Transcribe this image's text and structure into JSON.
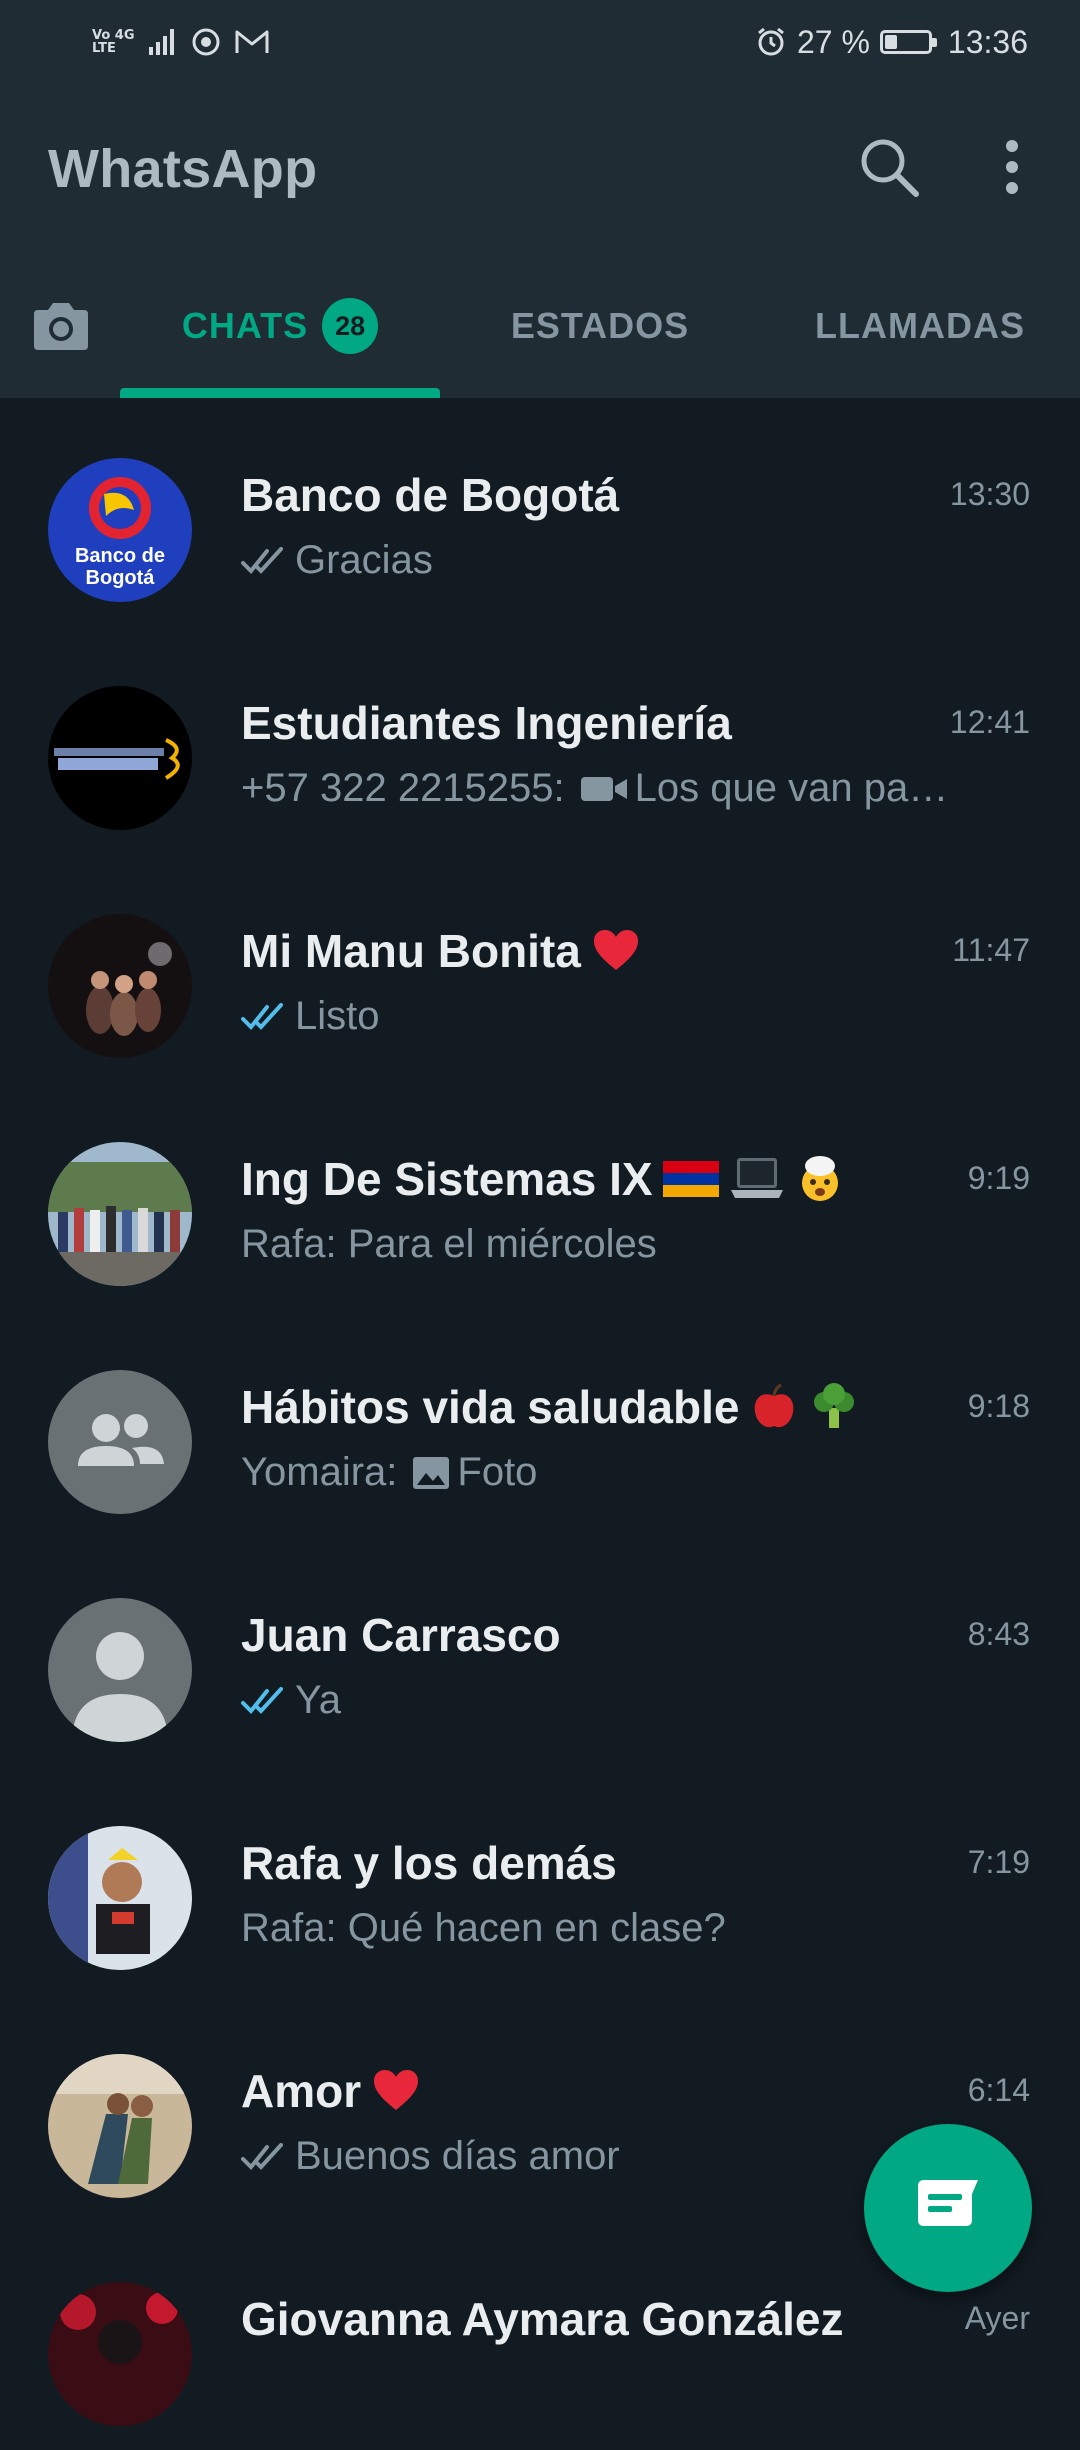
{
  "status_bar": {
    "network_top": "Vo 4G",
    "network_bottom": "LTE",
    "battery_percent": "27 %",
    "battery_level": 0.27,
    "time": "13:36"
  },
  "header": {
    "title": "WhatsApp",
    "icons": [
      "search-icon",
      "more-options-icon"
    ]
  },
  "tabs": [
    {
      "label": "CHATS",
      "badge": "28",
      "active": true
    },
    {
      "label": "ESTADOS",
      "active": false
    },
    {
      "label": "LLAMADAS",
      "active": false
    }
  ],
  "chats": [
    {
      "name": "Banco de Bogotá",
      "time": "13:30",
      "preview": "Gracias",
      "ticks": "read-grey",
      "avatar_text_1": "Banco de",
      "avatar_text_2": "Bogotá"
    },
    {
      "name": "Estudiantes Ingeniería",
      "time": "12:41",
      "preview_sender": "+57 322 2215255:",
      "preview": "Los que van pa…",
      "media": "video-icon"
    },
    {
      "name": "Mi Manu Bonita",
      "time": "11:47",
      "preview": "Listo",
      "ticks": "read-blue",
      "emoji": "heart"
    },
    {
      "name": "Ing De Sistemas IX",
      "time": "9:19",
      "preview": "Rafa: Para el miércoles"
    },
    {
      "name": "Hábitos vida saludable",
      "time": "9:18",
      "preview_sender": "Yomaira:",
      "preview": "Foto",
      "media": "photo-icon"
    },
    {
      "name": "Juan Carrasco",
      "time": "8:43",
      "preview": "Ya",
      "ticks": "read-blue"
    },
    {
      "name": "Rafa y los demás",
      "time": "7:19",
      "preview": "Rafa: Qué hacen en clase?"
    },
    {
      "name": "Amor",
      "time": "6:14",
      "preview": "Buenos días amor",
      "ticks": "read-grey",
      "emoji": "heart"
    },
    {
      "name": "Giovanna Aymara González",
      "time": "Ayer",
      "preview": ""
    }
  ],
  "colors": {
    "accent": "#00a884",
    "background": "#121b22",
    "header": "#1f2c34",
    "read_tick": "#53bdeb"
  }
}
